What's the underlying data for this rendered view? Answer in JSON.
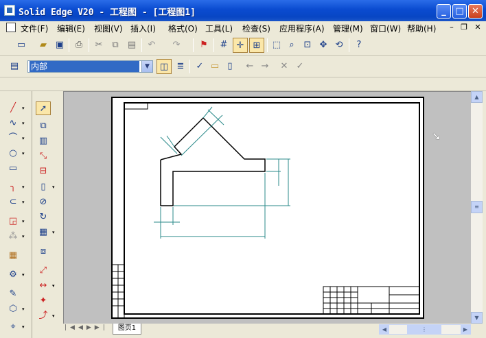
{
  "window": {
    "title": "Solid Edge V20 - 工程图 - [工程图1]",
    "minimize_label": "_",
    "maximize_label": "□",
    "close_label": "✕"
  },
  "menu": {
    "items": [
      "文件(F)",
      "编辑(E)",
      "视图(V)",
      "插入(I)",
      "格式(O)",
      "工具(L)",
      "检查(S)",
      "应用程序(A)",
      "管理(M)",
      "窗口(W)",
      "帮助(H)"
    ],
    "doc_min": "–",
    "doc_restore": "❐",
    "doc_close": "✕"
  },
  "layer_bar": {
    "combo_value": "内部"
  },
  "sheet": {
    "tab_label": "图页1"
  },
  "colors": {
    "title_bar": "#0a4bd0",
    "canvas": "#c0c0c0",
    "sheet": "#ffffff",
    "dimension": "#2a8a8a"
  }
}
